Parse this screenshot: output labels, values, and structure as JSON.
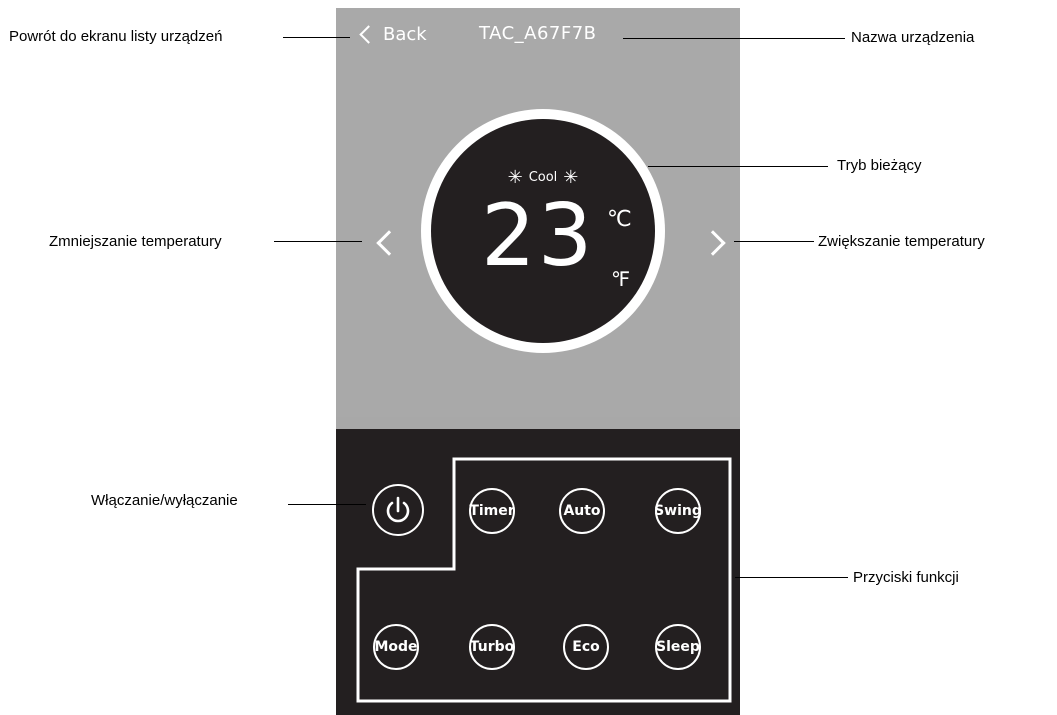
{
  "header": {
    "back_label": "Back",
    "device_name": "TAC_A67F7B"
  },
  "dial": {
    "mode": "Cool",
    "mode_icon": "snowflake-icon",
    "temperature": "23",
    "unit_c": "℃",
    "unit_f": "℉"
  },
  "buttons": {
    "power": "power-icon",
    "timer": "Timer",
    "auto": "Auto",
    "swing": "Swing",
    "mode": "Mode",
    "turbo": "Turbo",
    "eco": "Eco",
    "sleep": "Sleep"
  },
  "callouts": {
    "back": "Powrót do ekranu listy urządzeń",
    "device_name": "Nazwa urządzenia",
    "current_mode": "Tryb bieżący",
    "decrease": "Zmniejszanie temperatury",
    "increase": "Zwiększanie temperatury",
    "power": "Włączanie/wyłączanie",
    "function_buttons": "Przyciski funkcji"
  },
  "colors": {
    "screen_gray": "#a9a9a9",
    "panel_dark": "#231f20",
    "foreground": "#ffffff"
  }
}
